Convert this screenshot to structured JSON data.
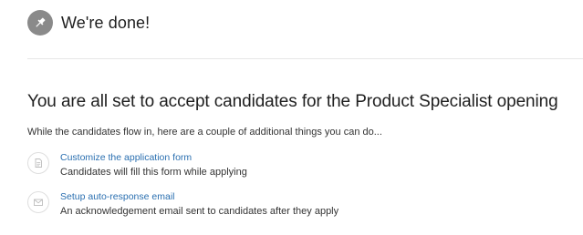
{
  "header": {
    "icon": "pushpin-icon",
    "title": "We're done!"
  },
  "main": {
    "heading": "You are all set to accept candidates for the Product Specialist opening",
    "intro": "While the candidates flow in, here are a couple of additional things you can do..."
  },
  "actions": [
    {
      "icon": "form-document-icon",
      "link_label": "Customize the application form",
      "description": "Candidates will fill this form while applying"
    },
    {
      "icon": "envelope-icon",
      "link_label": "Setup auto-response email",
      "description": "An acknowledgement email sent to candidates after they apply"
    }
  ],
  "colors": {
    "link": "#2a6fb0",
    "badge": "#8a8a8a",
    "divider": "#e6e6e6"
  }
}
